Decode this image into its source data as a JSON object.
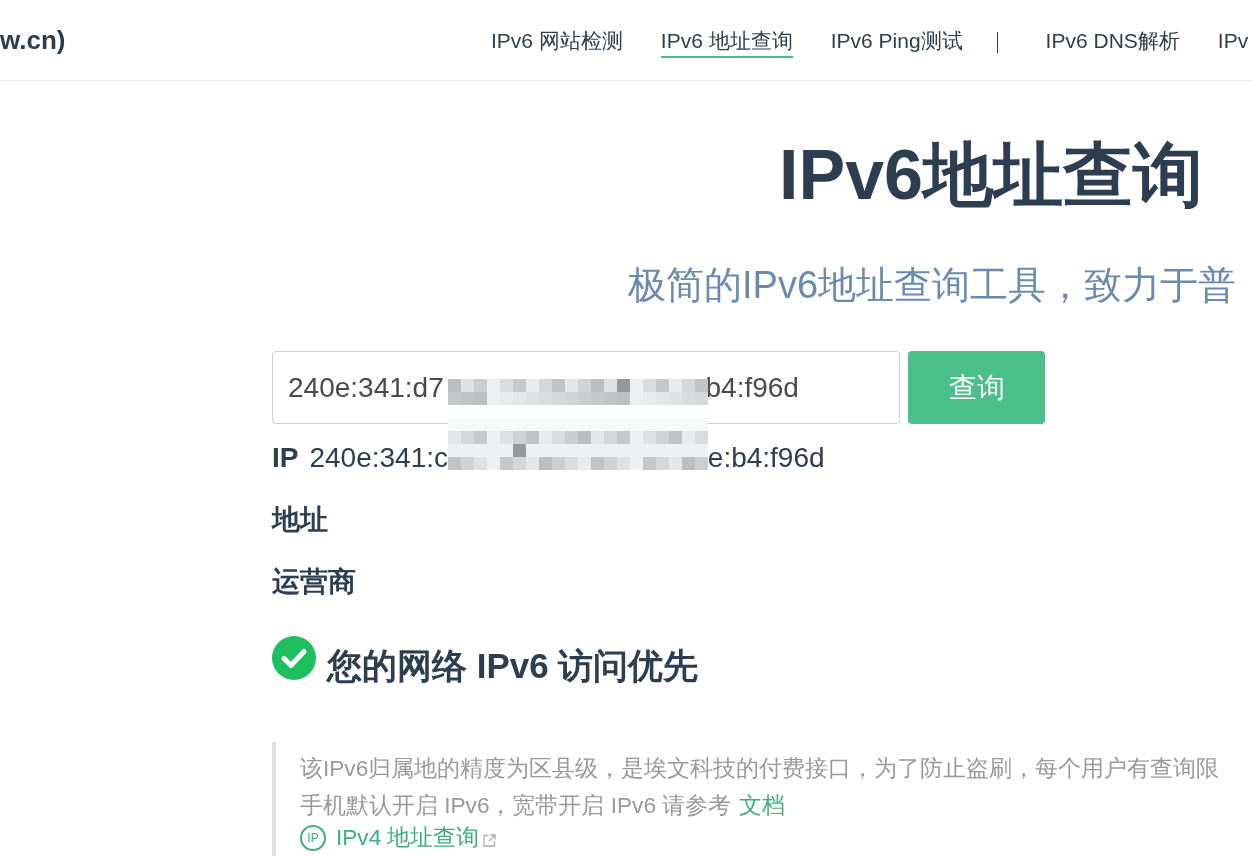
{
  "header": {
    "logo": "w.cn)",
    "nav": {
      "groups": [
        [
          {
            "label": "IPv6 网站检测",
            "selected": false
          },
          {
            "label": "IPv6 地址查询",
            "selected": true
          },
          {
            "label": "IPv6 Ping测试",
            "selected": false
          }
        ],
        [
          {
            "label": "IPv6 DNS解析",
            "selected": false
          },
          {
            "label": "IPv",
            "selected": false
          }
        ]
      ]
    }
  },
  "hero": {
    "title": "IPv6地址查询",
    "subtitle": "极简的IPv6地址查询工具，致力于普"
  },
  "query": {
    "input_value_parts": [
      "240e:341:d7",
      "b4:f96d"
    ],
    "button": "查询",
    "redacted": true,
    "results": [
      {
        "label": "IP",
        "value_parts": [
          "240e:341:c",
          "e:b4:f96d"
        ]
      },
      {
        "label": "地址"
      },
      {
        "label": "运营商"
      }
    ]
  },
  "status": {
    "ok": true,
    "text": "您的网络 IPv6 访问优先"
  },
  "note": {
    "lines": [
      {
        "text": "该IPv6归属地的精度为区县级，是埃文科技的付费接口，为了防止盗刷，每个用户有查询限"
      },
      {
        "text": "手机默认开启 IPv6，宽带开启 IPv6 请参考",
        "link": "文档"
      }
    ],
    "related_link": {
      "icon_label": "IP",
      "label": "IPv4 地址查询",
      "external": true
    }
  }
}
